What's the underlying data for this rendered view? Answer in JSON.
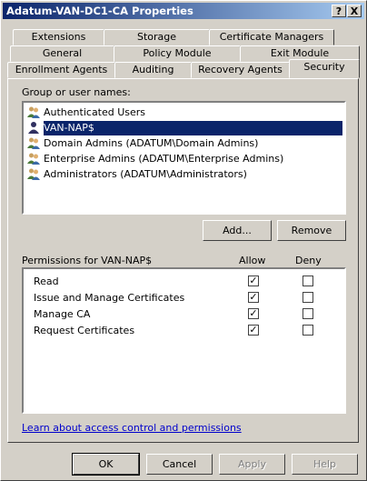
{
  "window": {
    "title": "Adatum-VAN-DC1-CA Properties",
    "help_btn": "?",
    "close_btn": "X"
  },
  "tabs": {
    "row1": [
      "Extensions",
      "Storage",
      "Certificate Managers"
    ],
    "row2": [
      "General",
      "Policy Module",
      "Exit Module"
    ],
    "row3": [
      "Enrollment Agents",
      "Auditing",
      "Recovery Agents",
      "Security"
    ],
    "active": "Security"
  },
  "group_label": "Group or user names:",
  "users": [
    {
      "name": "Authenticated Users",
      "icon": "users-group-icon",
      "selected": false
    },
    {
      "name": "VAN-NAP$",
      "icon": "computer-account-icon",
      "selected": true
    },
    {
      "name": "Domain Admins (ADATUM\\Domain Admins)",
      "icon": "users-group-icon",
      "selected": false
    },
    {
      "name": "Enterprise Admins (ADATUM\\Enterprise Admins)",
      "icon": "users-group-icon",
      "selected": false
    },
    {
      "name": "Administrators (ADATUM\\Administrators)",
      "icon": "users-group-icon",
      "selected": false
    }
  ],
  "add_label": "Add...",
  "remove_label": "Remove",
  "permissions": {
    "title": "Permissions for VAN-NAP$",
    "allow_header": "Allow",
    "deny_header": "Deny",
    "rows": [
      {
        "name": "Read",
        "allow": true,
        "deny": false
      },
      {
        "name": "Issue and Manage Certificates",
        "allow": true,
        "deny": false
      },
      {
        "name": "Manage CA",
        "allow": true,
        "deny": false
      },
      {
        "name": "Request Certificates",
        "allow": true,
        "deny": false
      }
    ]
  },
  "link_text": "Learn about access control and permissions",
  "footer": {
    "ok": "OK",
    "cancel": "Cancel",
    "apply": "Apply",
    "help": "Help"
  }
}
